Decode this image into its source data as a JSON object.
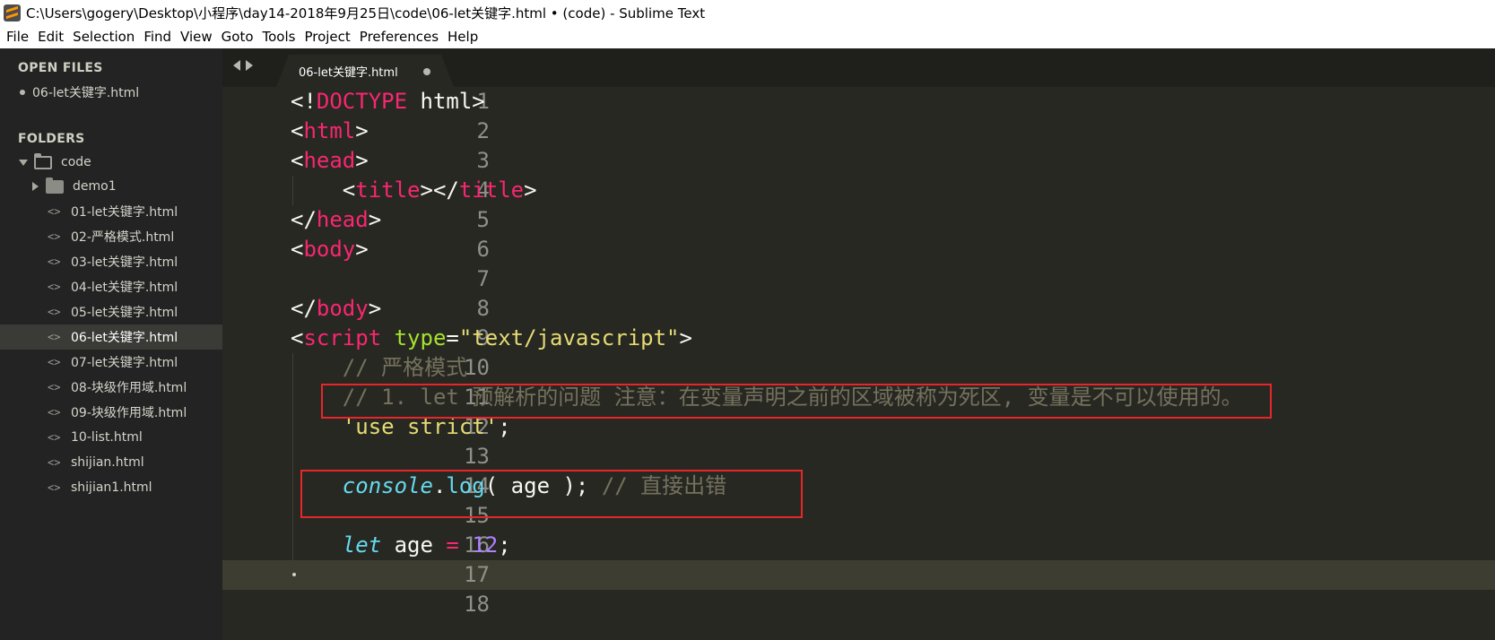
{
  "window": {
    "title": "C:\\Users\\gogery\\Desktop\\小程序\\day14-2018年9月25日\\code\\06-let关键字.html • (code) - Sublime Text"
  },
  "menu": [
    "File",
    "Edit",
    "Selection",
    "Find",
    "View",
    "Goto",
    "Tools",
    "Project",
    "Preferences",
    "Help"
  ],
  "sidebar": {
    "open_files_heading": "OPEN FILES",
    "open_files": [
      "06-let关键字.html"
    ],
    "folders_heading": "FOLDERS",
    "root_folder": "code",
    "subfolder": "demo1",
    "files": [
      "01-let关键字.html",
      "02-严格模式.html",
      "03-let关键字.html",
      "04-let关键字.html",
      "05-let关键字.html",
      "06-let关键字.html",
      "07-let关键字.html",
      "08-块级作用域.html",
      "09-块级作用域.html",
      "10-list.html",
      "shijian.html",
      "shijian1.html"
    ],
    "selected_file": "06-let关键字.html"
  },
  "tab": {
    "label": "06-let关键字.html"
  },
  "editor": {
    "line_numbers": [
      "1",
      "2",
      "3",
      "4",
      "5",
      "6",
      "7",
      "8",
      "9",
      "10",
      "11",
      "12",
      "13",
      "14",
      "15",
      "16",
      "17",
      "18"
    ],
    "current_line": "17",
    "tokens": {
      "l1_a": "<!",
      "l1_b": "DOCTYPE",
      "l1_c": " html>",
      "l2_a": "<",
      "l2_b": "html",
      "l2_c": ">",
      "l3_a": "<",
      "l3_b": "head",
      "l3_c": ">",
      "l4_a": "    <",
      "l4_b": "title",
      "l4_c": "></",
      "l4_d": "title",
      "l4_e": ">",
      "l5_a": "</",
      "l5_b": "head",
      "l5_c": ">",
      "l6_a": "<",
      "l6_b": "body",
      "l6_c": ">",
      "l8_a": "</",
      "l8_b": "body",
      "l8_c": ">",
      "l9_a": "<",
      "l9_b": "script",
      "l9_c": " ",
      "l9_d": "type",
      "l9_e": "=",
      "l9_f": "\"text/javascript\"",
      "l9_g": ">",
      "l10": "    // 严格模式",
      "l11": "    // 1. let 预解析的问题 注意：在变量声明之前的区域被称为死区, 变量是不可以使用的。",
      "l12_a": "    ",
      "l12_b": "'use strict'",
      "l12_c": ";",
      "l14_a": "    ",
      "l14_b": "console",
      "l14_c": ".",
      "l14_d": "log",
      "l14_e": "( age ); ",
      "l14_f": "// 直接出错",
      "l16_a": "    ",
      "l16_b": "let",
      "l16_c": " age ",
      "l16_d": "=",
      "l16_e": " ",
      "l16_f": "12",
      "l16_g": ";"
    }
  },
  "colors": {
    "tag": "#f92672",
    "attribute": "#a6e22e",
    "string": "#e6db74",
    "comment": "#75715e",
    "keyword": "#66d9ef",
    "number": "#ae81ff",
    "annotation_box": "#e8262a"
  }
}
